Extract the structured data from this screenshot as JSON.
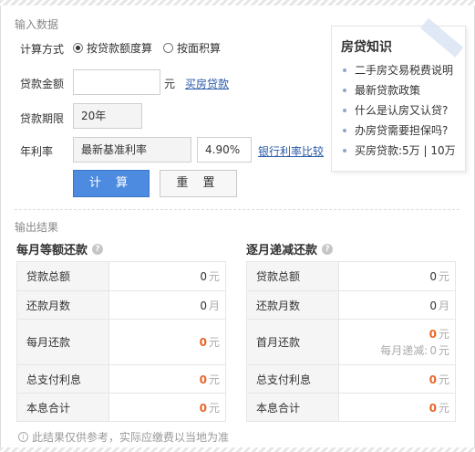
{
  "input_section": {
    "title": "输入数据",
    "calc_method": {
      "label": "计算方式",
      "options": [
        {
          "label": "按贷款额度算",
          "selected": true
        },
        {
          "label": "按面积算",
          "selected": false
        }
      ]
    },
    "loan_amount": {
      "label": "贷款金额",
      "value": "",
      "unit": "元",
      "link": "买房贷款"
    },
    "loan_term": {
      "label": "贷款期限",
      "value": "20年"
    },
    "annual_rate": {
      "label": "年利率",
      "rate_type": "最新基准利率",
      "rate_value": "4.90%",
      "link": "银行利率比较"
    },
    "buttons": {
      "calculate": "计 算",
      "reset": "重 置"
    }
  },
  "knowledge": {
    "title": "房贷知识",
    "items": [
      "二手房交易税费说明",
      "最新贷款政策",
      "什么是认房又认贷?",
      "办房贷需要担保吗?",
      "买房贷款:5万 | 10万"
    ]
  },
  "output_section": {
    "title": "输出结果",
    "equal_payment": {
      "title": "每月等额还款",
      "rows": [
        {
          "label": "贷款总额",
          "value": "0",
          "unit": "元"
        },
        {
          "label": "还款月数",
          "value": "0",
          "unit": "月"
        },
        {
          "label": "每月还款",
          "value": "0",
          "unit": "元"
        },
        {
          "label": "总支付利息",
          "value": "0",
          "unit": "元"
        },
        {
          "label": "本息合计",
          "value": "0",
          "unit": "元"
        }
      ]
    },
    "decreasing_payment": {
      "title": "逐月递减还款",
      "rows": [
        {
          "label": "贷款总额",
          "value": "0",
          "unit": "元"
        },
        {
          "label": "还款月数",
          "value": "0",
          "unit": "月"
        },
        {
          "label": "首月还款",
          "value": "0",
          "unit": "元",
          "sub_label": "每月递减:",
          "sub_value": "0",
          "sub_unit": "元"
        },
        {
          "label": "总支付利息",
          "value": "0",
          "unit": "元"
        },
        {
          "label": "本息合计",
          "value": "0",
          "unit": "元"
        }
      ]
    },
    "note": "此结果仅供参考，实际应缴费以当地为准"
  },
  "colors": {
    "accent": "#4d8be0",
    "highlight": "#e8662a",
    "link": "#2a5aa8"
  }
}
